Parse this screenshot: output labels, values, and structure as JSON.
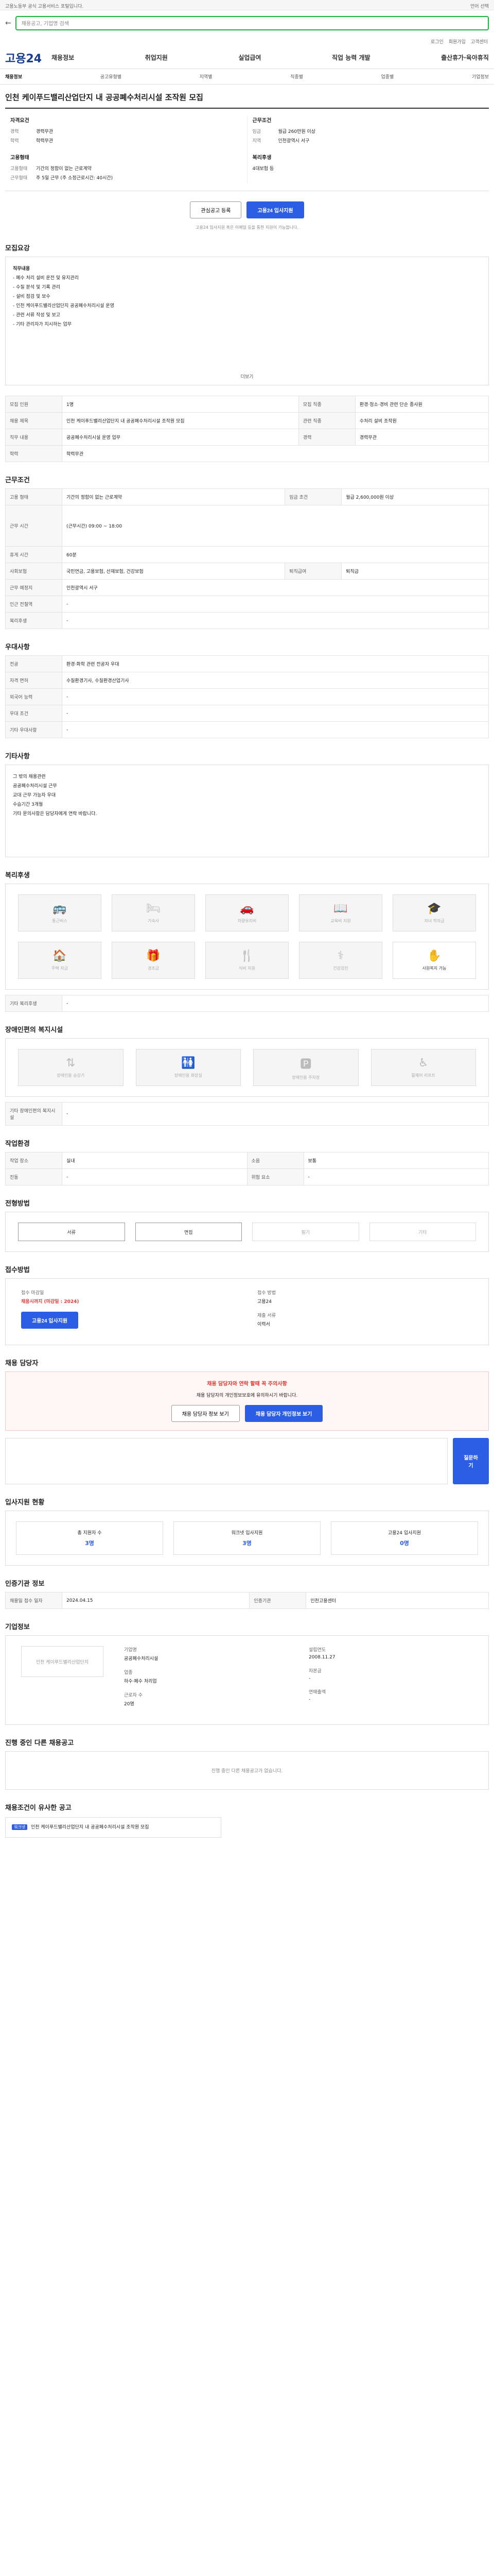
{
  "top": {
    "left": "고용노동부 공식 고용서비스 포털입니다.",
    "right": "언어 선택"
  },
  "search": {
    "placeholder": "채용공고, 기업명 검색"
  },
  "util": [
    "로그인",
    "회원가입",
    "고객센터"
  ],
  "gnb": {
    "logo": "고용24",
    "menu": [
      "채용정보",
      "취업지원",
      "실업급여",
      "직업 능력 개발",
      "출산휴가·육아휴직"
    ]
  },
  "subnav": {
    "home": "채용정보",
    "items": [
      "공고유형별",
      "지역별",
      "직종별",
      "업종별",
      "기업정보"
    ]
  },
  "job": {
    "title": "인천 케이푸드밸리산업단지 내 공공폐수처리시설 조작원 모집",
    "left_h": "자격요건",
    "right_h": "근무조건",
    "left": [
      {
        "k": "경력",
        "v": "경력무관"
      },
      {
        "k": "학력",
        "v": "학력무관"
      }
    ],
    "right": [
      {
        "k": "임금",
        "v": "월급 260만원 이상"
      },
      {
        "k": "지역",
        "v": "인천광역시 서구"
      }
    ],
    "left2_h": "고용형태",
    "left2": [
      {
        "k": "고용형태",
        "v": "기간의 정함이 없는 근로계약"
      },
      {
        "k": "근무형태",
        "v": "주 5일 근무 (주 소정근로시간: 40시간)"
      }
    ],
    "right2_h": "복리후생",
    "right2": [
      {
        "k": "",
        "v": "4대보험 등"
      }
    ],
    "btn_scrap": "관심공고 등록",
    "btn_apply": "고용24 입사지원",
    "note": "고용24 입사지원 혹은 이메일 등을 통한 지원이 가능합니다."
  },
  "sec_content": {
    "h": "모집요강",
    "lines": [
      "직무내용",
      "- 폐수 처리 설비 운전 및 유지관리",
      "- 수질 분석 및 기록 관리",
      "- 설비 점검 및 보수",
      "- 인천 케이푸드밸리산업단지 공공폐수처리시설 운영",
      "- 관련 서류 작성 및 보고",
      "- 기타 관리자가 지시하는 업무"
    ],
    "more": "더보기"
  },
  "table1": [
    {
      "k": "모집 인원",
      "v": "1명"
    },
    {
      "k": "모집 직종",
      "v": "환경·청소·경비 관련 단순 종사원"
    },
    {
      "k": "채용 제목",
      "v": "인천 케이푸드밸리산업단지 내 공공폐수처리시설 조작원 모집"
    },
    {
      "k": "관련 직종",
      "v": "수처리 설비 조작원"
    },
    {
      "k": "직무 내용",
      "v": "공공폐수처리시설 운영 업무"
    },
    {
      "k": "경력",
      "v": "경력무관"
    },
    {
      "k": "학력",
      "v": "학력무관"
    }
  ],
  "sec_cond": {
    "h": "근무조건"
  },
  "table2": [
    {
      "k": "고용 형태",
      "v": "기간의 정함이 없는 근로계약"
    },
    {
      "k": "임금 조건",
      "v": "월급 2,600,000원 이상"
    },
    {
      "k": "근무 시간",
      "v": "(근무시간) 09:00 ~ 18:00"
    },
    {
      "k": "휴게 시간",
      "v": "60분"
    },
    {
      "k": "사회보험",
      "v": "국민연금, 고용보험, 산재보험, 건강보험"
    },
    {
      "k": "퇴직급여",
      "v": "퇴직금"
    },
    {
      "k": "근무 예정지",
      "v": "인천광역시 서구"
    },
    {
      "k": "인근 전철역",
      "v": "-"
    },
    {
      "k": "복리후생",
      "v": "-"
    }
  ],
  "sec_apply": {
    "h": "우대사항"
  },
  "table3": [
    {
      "k": "전공",
      "v": "환경·화학 관련 전공자 우대"
    },
    {
      "k": "자격 면허",
      "v": "수질환경기사, 수질환경산업기사"
    },
    {
      "k": "외국어 능력",
      "v": "-"
    },
    {
      "k": "우대 조건",
      "v": "-"
    },
    {
      "k": "기타 우대사항",
      "v": "-"
    }
  ],
  "sec_etc": {
    "h": "기타사항",
    "lines": [
      "그 밖의 채용관련",
      "공공폐수처리시설 근무",
      "교대 근무 가능자 우대",
      "수습기간 3개월",
      "기타 문의사항은 담당자에게 연락 바랍니다."
    ]
  },
  "sec_benefit": {
    "h": "복리후생",
    "items": [
      "통근버스",
      "기숙사",
      "차량유지비",
      "교육비 지원",
      "자녀 학자금",
      "주택 자금",
      "경조금",
      "식비 지원",
      "건강검진",
      "사원복지 가능"
    ],
    "etc_label": "기타 복리후생",
    "etc": "-"
  },
  "sec_disabled": {
    "h": "장애인편의 복지시설",
    "items": [
      "장애인용 승강기",
      "장애인용 화장실",
      "장애인용 주차장",
      "휠체어 리프트"
    ],
    "etc_label": "기타 장애인편의 복지시설",
    "etc": "-"
  },
  "sec_work": {
    "h": "작업환경"
  },
  "table4": [
    {
      "k": "작업 장소",
      "v": "실내"
    },
    {
      "k": "소음",
      "v": "보통"
    },
    {
      "k": "진동",
      "v": "-"
    },
    {
      "k": "위험 요소",
      "v": "-"
    }
  ],
  "sec_method": {
    "h": "전형방법",
    "items": [
      "서류",
      "면접",
      "필기",
      "기타"
    ]
  },
  "sec_recv": {
    "h": "접수방법",
    "c1_l": "접수 마감일",
    "c1_v": "채용시까지 (마감일 : 2024)",
    "c1_btn": "고용24 입사지원",
    "c2_l": "접수 방법",
    "c2_v": "고용24",
    "c3_l": "제출 서류",
    "c3_v": "이력서"
  },
  "sec_contact": {
    "h": "채용 담당자",
    "warn_t": "채용 담당자와 연락 할때 꼭 주의사항",
    "warn_body": "채용 담당자의 개인정보보호에 유의하시기 바랍니다.",
    "btn1": "채용 담당자 정보 보기",
    "btn2": "채용 담당자 개인정보 보기",
    "btn_ask": "질문하기"
  },
  "sec_stats": {
    "h": "입사지원 현황",
    "items": [
      {
        "l": "총 지원자 수",
        "n": "3명"
      },
      {
        "l": "워크넷 입사지원 ",
        "n": "3명"
      },
      {
        "l": "고용24 입사지원",
        "n": "0명"
      }
    ]
  },
  "sec_agency": {
    "h": "인증기관 정보",
    "rows": [
      {
        "k": "채용일 접수 일자",
        "v": "2024.04.15"
      },
      {
        "k": "인증기관",
        "v": "인천고용센터"
      }
    ]
  },
  "sec_company": {
    "h": "기업정보",
    "name": "인천 케이푸드밸리산업단지",
    "rows": [
      {
        "k": "기업명",
        "v": "공공폐수처리시설"
      },
      {
        "k": "업종",
        "v": "하수·폐수 처리업"
      },
      {
        "k": "근로자 수",
        "v": "20명"
      },
      {
        "k": "설립연도",
        "v": "2008.11.27"
      },
      {
        "k": "자본금",
        "v": "-"
      },
      {
        "k": "연매출액",
        "v": "-"
      }
    ]
  },
  "sec_other": {
    "h": "진행 중인 다른 채용공고",
    "empty": "진행 중인 다른 채용공고가 없습니다."
  },
  "sec_related": {
    "h": "채용조건이 유사한 공고",
    "tag": "워크넷",
    "text": "인천 케이푸드밸리산업단지 내 공공폐수처리시설 조작원 모집"
  }
}
